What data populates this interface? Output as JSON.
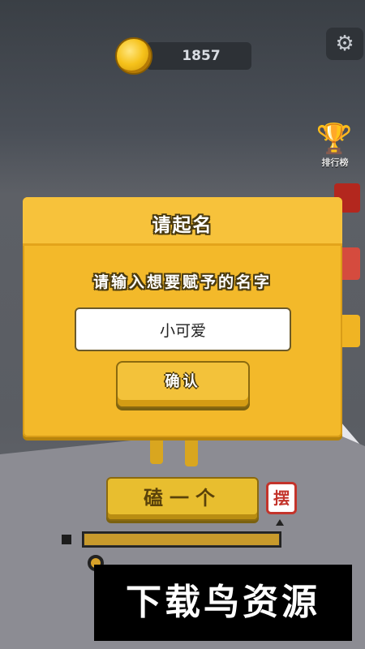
{
  "hud": {
    "coins": "1857",
    "rank_label": "排行榜"
  },
  "icons": {
    "coin": "coin-icon",
    "settings": "gear-icon",
    "trophy": "trophy-icon"
  },
  "game": {
    "knock_button": "磕一个",
    "pendulum_button": "摆"
  },
  "dialog": {
    "title": "请起名",
    "prompt": "请输入想要赋予的名字",
    "input_value": "小可爱",
    "confirm_label": "确认"
  },
  "watermark": "下载鸟资源",
  "colors": {
    "dialog_bg": "#f3b92a",
    "button_yellow": "#f3c23a",
    "hud_dark": "#2d3136"
  }
}
